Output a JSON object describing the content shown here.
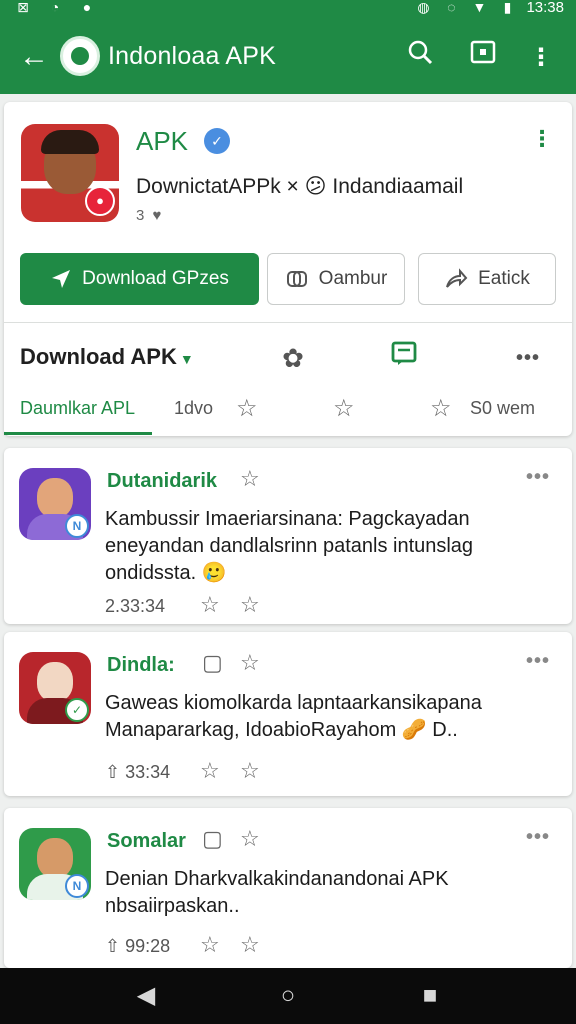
{
  "status_bar": {
    "time": "13:38"
  },
  "app_bar": {
    "title": "Indonloaa APK"
  },
  "app": {
    "title": "APK",
    "subtitle": "DownictatAPPk × 😕 Indandiaamail",
    "meta": "3"
  },
  "buttons": {
    "primary": "Download GPzes",
    "secondary1": "Oambur",
    "secondary2": "Eatick"
  },
  "section": {
    "title": "Download APK",
    "tabs": [
      "Daumlkar APL",
      "1dvo",
      "S0 wem"
    ]
  },
  "posts": [
    {
      "author": "Dutanidarik",
      "text": "Kambussir Imaeriarsinana: Pagckayadan eneyandan dandlalsrinn patanls intunslag ondidssta. 🥲",
      "stats": "2.33:34",
      "avatar_colors": {
        "bg": "#6b3fbf",
        "head": "#e2a57a",
        "body": "#8d6ad6"
      }
    },
    {
      "author": "Dindla:",
      "text": "Gaweas kiomolkarda lapntaarkansikapana Manapararkag, IdoabioRayahom 🥜 D..",
      "stats": "33:34",
      "avatar_colors": {
        "bg": "#b8262c",
        "head": "#f2d7c3",
        "body": "#c9322f"
      }
    },
    {
      "author": "Somalar",
      "text": "Denian Dharkvalkakindanandonai APK nbsaiirpaskan..",
      "stats": "99:28",
      "avatar_colors": {
        "bg": "#2f9b4a",
        "head": "#d69a68",
        "body": "#2f9b4a"
      }
    }
  ]
}
